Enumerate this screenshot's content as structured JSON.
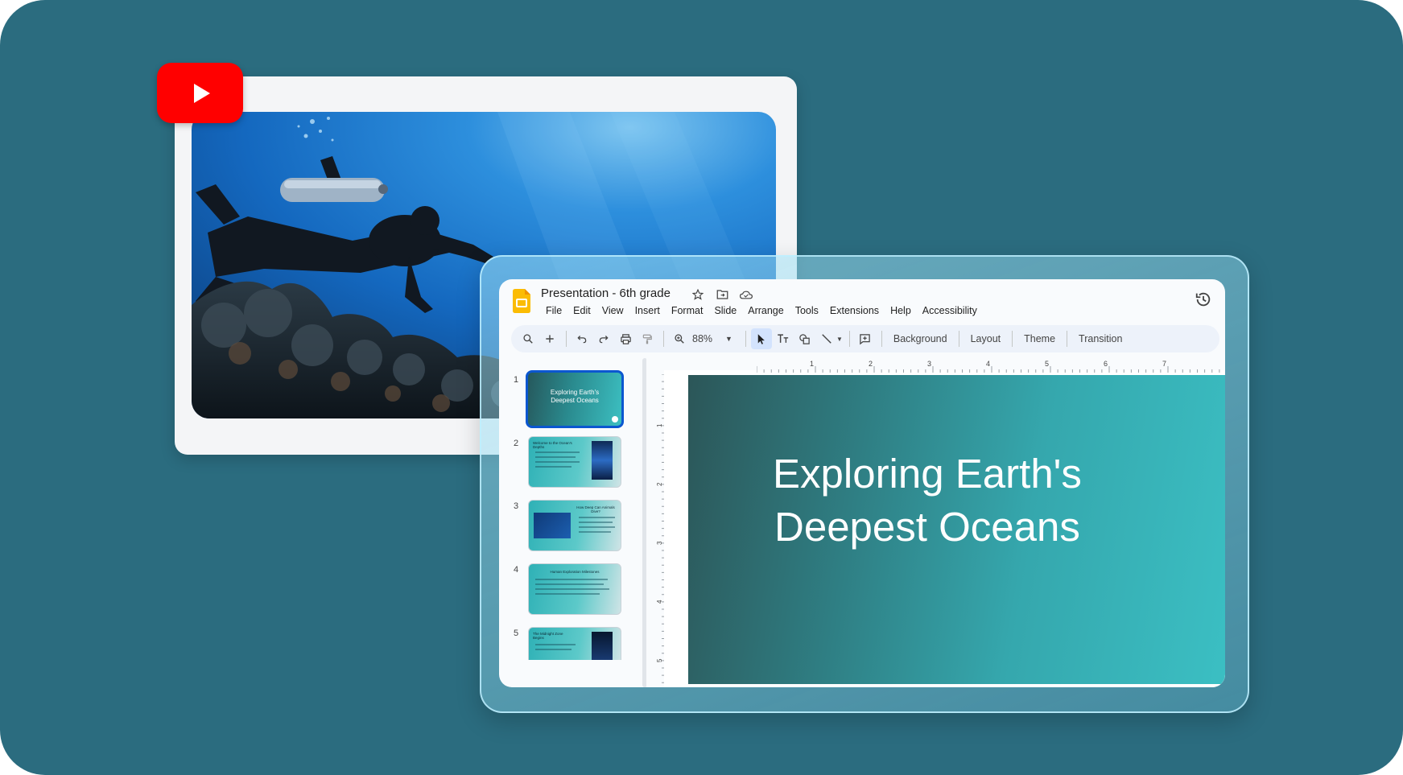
{
  "document": {
    "title": "Presentation - 6th grade",
    "title_icons": [
      "star-icon",
      "move-to-folder-icon",
      "cloud-status-icon"
    ]
  },
  "menu": [
    "File",
    "Edit",
    "View",
    "Insert",
    "Format",
    "Slide",
    "Arrange",
    "Tools",
    "Extensions",
    "Help",
    "Accessibility"
  ],
  "toolbar": {
    "zoom": "88%",
    "background_label": "Background",
    "layout_label": "Layout",
    "theme_label": "Theme",
    "transition_label": "Transition"
  },
  "ruler": {
    "horizontal": [
      "1",
      "2",
      "3",
      "4",
      "5",
      "6",
      "7"
    ],
    "vertical": [
      "1",
      "2",
      "3",
      "4",
      "5"
    ]
  },
  "filmstrip": [
    {
      "number": "1",
      "title": "Exploring Earth's Deepest Oceans"
    },
    {
      "number": "2",
      "title": "Welcome to the Ocean's Depths"
    },
    {
      "number": "3",
      "title": "How Deep Can Animals Dive?"
    },
    {
      "number": "4",
      "title": "Human Exploration Milestones"
    },
    {
      "number": "5",
      "title": "The Midnight Zone Begins"
    }
  ],
  "current_slide": {
    "title_line1": "Exploring Earth's",
    "title_line2": "Deepest Oceans"
  },
  "colors": {
    "background": "#2b6c7f",
    "youtube_red": "#ff0000",
    "slides_yellow": "#fbbc04",
    "selection_blue": "#0b57d0",
    "slide_gradient_start": "#2c5658",
    "slide_gradient_end": "#3bbfc3"
  },
  "video": {
    "badge_icon": "youtube-play-icon",
    "scene": "scuba-diver-over-coral-reef"
  }
}
